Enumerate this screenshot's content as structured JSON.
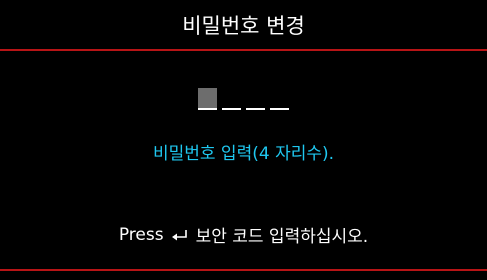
{
  "window": {
    "title": "비밀번호 변경"
  },
  "pin_entry": {
    "slots": 4,
    "filled": 1
  },
  "instruction": {
    "text": "비밀번호 입력(4 자리수)."
  },
  "hint": {
    "press_label": "Press",
    "key_icon": "enter-icon",
    "action_text": "보안 코드 입력하십시오."
  },
  "colors": {
    "background": "#000000",
    "divider": "#b81416",
    "instruction": "#1fc8f0",
    "text": "#ffffff"
  }
}
